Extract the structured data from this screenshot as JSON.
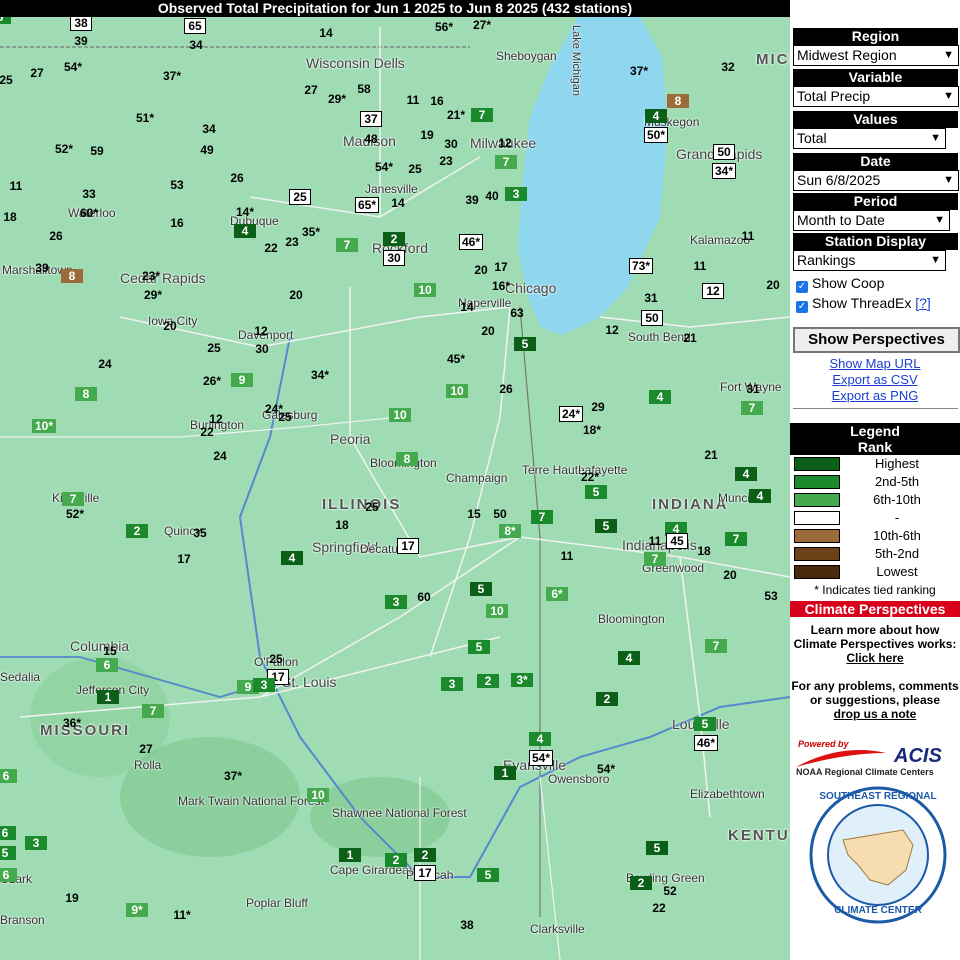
{
  "title": "Observed Total Precipitation for Jun 1 2025 to Jun 8 2025 (432 stations)",
  "panel": {
    "region_header": "Region",
    "region_value": "Midwest Region",
    "variable_header": "Variable",
    "variable_value": "Total Precip",
    "values_header": "Values",
    "values_value": "Total",
    "date_header": "Date",
    "date_value": "Sun 6/8/2025",
    "period_header": "Period",
    "period_value": "Month to Date",
    "station_header": "Station Display",
    "station_value": "Rankings",
    "show_coop": "Show Coop",
    "show_threadex": "Show ThreadEx",
    "help_link": "[?]",
    "show_perspectives": "Show Perspectives",
    "links": [
      "Show Map URL",
      "Export as CSV",
      "Export as PNG"
    ],
    "legend_title": "Legend",
    "legend_subtitle": "Rank",
    "legend": [
      {
        "label": "Highest",
        "color": "#0b5f17"
      },
      {
        "label": "2nd-5th",
        "color": "#1b8a2c"
      },
      {
        "label": "6th-10th",
        "color": "#45a94e"
      },
      {
        "label": "-",
        "color": "#ffffff"
      },
      {
        "label": "10th-6th",
        "color": "#9c6b3a"
      },
      {
        "label": "5th-2nd",
        "color": "#6b4218"
      },
      {
        "label": "Lowest",
        "color": "#4a2a0c"
      }
    ],
    "tied_note": "* Indicates tied ranking",
    "cp_header": "Climate Perspectives",
    "cp_text": "Learn more about how Climate Perspectives works:",
    "cp_link": "Click here",
    "problems_text": "For any problems, comments or suggestions, please",
    "problems_link": "drop us a note",
    "powered_by": "Powered by",
    "acis": "ACIS",
    "acis_sub": "NOAA Regional Climate Centers",
    "seal_top": "SOUTHEAST REGIONAL",
    "seal_bottom": "CLIMATE CENTER"
  },
  "map": {
    "places": [
      {
        "t": "Wisconsin Dells",
        "c": "med"
      },
      {
        "t": "Madison",
        "c": "med"
      },
      {
        "t": "Janesville",
        "c": ""
      },
      {
        "t": "Rockford",
        "c": "med"
      },
      {
        "t": "Milwaukee",
        "c": "med"
      },
      {
        "t": "Sheboygan",
        "c": ""
      },
      {
        "t": "Chicago",
        "c": "med"
      },
      {
        "t": "Naperville",
        "c": ""
      },
      {
        "t": "Cedar Rapids",
        "c": "med"
      },
      {
        "t": "Waterloo",
        "c": ""
      },
      {
        "t": "Dubuque",
        "c": ""
      },
      {
        "t": "Iowa City",
        "c": ""
      },
      {
        "t": "Davenport",
        "c": ""
      },
      {
        "t": "Galesburg",
        "c": ""
      },
      {
        "t": "Burlington",
        "c": ""
      },
      {
        "t": "Peoria",
        "c": "med"
      },
      {
        "t": "Bloomington",
        "c": ""
      },
      {
        "t": "ILLINOIS",
        "c": "big"
      },
      {
        "t": "Champaign",
        "c": ""
      },
      {
        "t": "Springfield",
        "c": "med"
      },
      {
        "t": "Decatur",
        "c": ""
      },
      {
        "t": "Quincy",
        "c": ""
      },
      {
        "t": "Kirksville",
        "c": ""
      },
      {
        "t": "Terre Haute",
        "c": ""
      },
      {
        "t": "Lafayette",
        "c": ""
      },
      {
        "t": "INDIANA",
        "c": "big"
      },
      {
        "t": "Indianapolis",
        "c": "med"
      },
      {
        "t": "Muncie",
        "c": ""
      },
      {
        "t": "Greenwood",
        "c": ""
      },
      {
        "t": "Bloomington",
        "c": ""
      },
      {
        "t": "Columbia",
        "c": "med"
      },
      {
        "t": "Jefferson City",
        "c": ""
      },
      {
        "t": "MISSOURI",
        "c": "big"
      },
      {
        "t": "Rolla",
        "c": ""
      },
      {
        "t": "O'Fallon",
        "c": ""
      },
      {
        "t": "St. Louis",
        "c": "med"
      },
      {
        "t": "Mark Twain National Forest",
        "c": ""
      },
      {
        "t": "Shawnee National Forest",
        "c": ""
      },
      {
        "t": "Cape Girardeau",
        "c": ""
      },
      {
        "t": "Poplar Bluff",
        "c": ""
      },
      {
        "t": "Paducah",
        "c": ""
      },
      {
        "t": "Evansville",
        "c": "med"
      },
      {
        "t": "Owensboro",
        "c": ""
      },
      {
        "t": "Louisville",
        "c": "med"
      },
      {
        "t": "Elizabethtown",
        "c": ""
      },
      {
        "t": "KENTUCKY",
        "c": "big"
      },
      {
        "t": "Bowling Green",
        "c": ""
      },
      {
        "t": "Clarksville",
        "c": ""
      },
      {
        "t": "Grand Rapids",
        "c": "med"
      },
      {
        "t": "Muskegon",
        "c": ""
      },
      {
        "t": "Kalamazoo",
        "c": ""
      },
      {
        "t": "South Bend",
        "c": ""
      },
      {
        "t": "Fort Wayne",
        "c": ""
      },
      {
        "t": "Sedalia",
        "c": ""
      },
      {
        "t": "Marshalltown",
        "c": ""
      },
      {
        "t": "Ozark",
        "c": ""
      },
      {
        "t": "Branson",
        "c": ""
      },
      {
        "t": "MICH",
        "c": "big"
      },
      {
        "t": "Lake Michigan",
        "c": ""
      }
    ],
    "stations": [
      {
        "v": "38",
        "k": "box"
      },
      {
        "v": "65",
        "k": "box"
      },
      {
        "v": "39",
        "k": ""
      },
      {
        "v": "34",
        "k": ""
      },
      {
        "v": "14",
        "k": ""
      },
      {
        "v": "56*",
        "k": ""
      },
      {
        "v": "27*",
        "k": ""
      },
      {
        "v": "25",
        "k": ""
      },
      {
        "v": "27",
        "k": ""
      },
      {
        "v": "54*",
        "k": ""
      },
      {
        "v": "37*",
        "k": ""
      },
      {
        "v": "27",
        "k": ""
      },
      {
        "v": "29*",
        "k": ""
      },
      {
        "v": "58",
        "k": ""
      },
      {
        "v": "11",
        "k": ""
      },
      {
        "v": "16",
        "k": ""
      },
      {
        "v": "37*",
        "k": ""
      },
      {
        "v": "32",
        "k": ""
      },
      {
        "v": "8",
        "k": "br"
      },
      {
        "v": "51*",
        "k": ""
      },
      {
        "v": "34",
        "k": ""
      },
      {
        "v": "37",
        "k": "box"
      },
      {
        "v": "21*",
        "k": ""
      },
      {
        "v": "7",
        "k": "md"
      },
      {
        "v": "4",
        "k": "dk"
      },
      {
        "v": "50*",
        "k": "box"
      },
      {
        "v": "52*",
        "k": ""
      },
      {
        "v": "59",
        "k": ""
      },
      {
        "v": "49",
        "k": ""
      },
      {
        "v": "48",
        "k": ""
      },
      {
        "v": "19",
        "k": ""
      },
      {
        "v": "30",
        "k": ""
      },
      {
        "v": "12",
        "k": ""
      },
      {
        "v": "50",
        "k": "box"
      },
      {
        "v": "34*",
        "k": "box"
      },
      {
        "v": "23",
        "k": ""
      },
      {
        "v": "7",
        "k": "lt"
      },
      {
        "v": "26",
        "k": ""
      },
      {
        "v": "54*",
        "k": ""
      },
      {
        "v": "25",
        "k": ""
      },
      {
        "v": "11",
        "k": ""
      },
      {
        "v": "53",
        "k": ""
      },
      {
        "v": "33",
        "k": ""
      },
      {
        "v": "25",
        "k": "box"
      },
      {
        "v": "40",
        "k": ""
      },
      {
        "v": "3",
        "k": "md"
      },
      {
        "v": "39",
        "k": ""
      },
      {
        "v": "18",
        "k": ""
      },
      {
        "v": "60*",
        "k": ""
      },
      {
        "v": "16",
        "k": ""
      },
      {
        "v": "14*",
        "k": ""
      },
      {
        "v": "65*",
        "k": "box"
      },
      {
        "v": "14",
        "k": ""
      },
      {
        "v": "4",
        "k": "dk"
      },
      {
        "v": "35*",
        "k": ""
      },
      {
        "v": "26",
        "k": ""
      },
      {
        "v": "22",
        "k": ""
      },
      {
        "v": "23",
        "k": ""
      },
      {
        "v": "7",
        "k": "lt"
      },
      {
        "v": "2",
        "k": "dk"
      },
      {
        "v": "46*",
        "k": "box"
      },
      {
        "v": "11",
        "k": ""
      },
      {
        "v": "39",
        "k": ""
      },
      {
        "v": "8",
        "k": "br"
      },
      {
        "v": "23*",
        "k": ""
      },
      {
        "v": "30",
        "k": "box"
      },
      {
        "v": "29*",
        "k": ""
      },
      {
        "v": "20",
        "k": ""
      },
      {
        "v": "17",
        "k": ""
      },
      {
        "v": "73*",
        "k": "box"
      },
      {
        "v": "11",
        "k": ""
      },
      {
        "v": "20",
        "k": ""
      },
      {
        "v": "10",
        "k": "lt"
      },
      {
        "v": "16*",
        "k": ""
      },
      {
        "v": "31",
        "k": ""
      },
      {
        "v": "12",
        "k": "box"
      },
      {
        "v": "20",
        "k": ""
      },
      {
        "v": "20",
        "k": ""
      },
      {
        "v": "14",
        "k": ""
      },
      {
        "v": "63",
        "k": ""
      },
      {
        "v": "20",
        "k": ""
      },
      {
        "v": "12",
        "k": ""
      },
      {
        "v": "50",
        "k": "box"
      },
      {
        "v": "12",
        "k": ""
      },
      {
        "v": "21",
        "k": ""
      },
      {
        "v": "30",
        "k": ""
      },
      {
        "v": "25",
        "k": ""
      },
      {
        "v": "5",
        "k": "dk"
      },
      {
        "v": "24",
        "k": ""
      },
      {
        "v": "45*",
        "k": ""
      },
      {
        "v": "26*",
        "k": ""
      },
      {
        "v": "9",
        "k": "lt"
      },
      {
        "v": "34*",
        "k": ""
      },
      {
        "v": "26",
        "k": ""
      },
      {
        "v": "10",
        "k": "lt"
      },
      {
        "v": "8",
        "k": "lt"
      },
      {
        "v": "31",
        "k": ""
      },
      {
        "v": "24*",
        "k": "box"
      },
      {
        "v": "29",
        "k": ""
      },
      {
        "v": "4",
        "k": "md"
      },
      {
        "v": "7",
        "k": "lt"
      },
      {
        "v": "24*",
        "k": ""
      },
      {
        "v": "25",
        "k": ""
      },
      {
        "v": "10",
        "k": "lt"
      },
      {
        "v": "12",
        "k": ""
      },
      {
        "v": "10*",
        "k": "lt"
      },
      {
        "v": "22",
        "k": ""
      },
      {
        "v": "18*",
        "k": ""
      },
      {
        "v": "8",
        "k": "lt"
      },
      {
        "v": "21",
        "k": ""
      },
      {
        "v": "24",
        "k": ""
      },
      {
        "v": "22*",
        "k": ""
      },
      {
        "v": "4",
        "k": "dk"
      },
      {
        "v": "5",
        "k": "md"
      },
      {
        "v": "4",
        "k": "dk"
      },
      {
        "v": "7",
        "k": "lt"
      },
      {
        "v": "52*",
        "k": ""
      },
      {
        "v": "25",
        "k": ""
      },
      {
        "v": "15",
        "k": ""
      },
      {
        "v": "50",
        "k": ""
      },
      {
        "v": "7",
        "k": "md"
      },
      {
        "v": "5",
        "k": "dk"
      },
      {
        "v": "4",
        "k": "md"
      },
      {
        "v": "2",
        "k": "md"
      },
      {
        "v": "35",
        "k": ""
      },
      {
        "v": "18",
        "k": ""
      },
      {
        "v": "17",
        "k": "box"
      },
      {
        "v": "11",
        "k": ""
      },
      {
        "v": "45",
        "k": "box"
      },
      {
        "v": "7",
        "k": "md"
      },
      {
        "v": "8*",
        "k": "lt"
      },
      {
        "v": "11",
        "k": ""
      },
      {
        "v": "7",
        "k": "lt"
      },
      {
        "v": "18",
        "k": ""
      },
      {
        "v": "17",
        "k": ""
      },
      {
        "v": "4",
        "k": "dk"
      },
      {
        "v": "20",
        "k": ""
      },
      {
        "v": "6*",
        "k": "lt"
      },
      {
        "v": "5",
        "k": "dk"
      },
      {
        "v": "53",
        "k": ""
      },
      {
        "v": "3",
        "k": "md"
      },
      {
        "v": "60",
        "k": ""
      },
      {
        "v": "10",
        "k": "lt"
      },
      {
        "v": "4",
        "k": "md"
      },
      {
        "v": "6",
        "k": "lt"
      },
      {
        "v": "5",
        "k": "md"
      },
      {
        "v": "4",
        "k": "dk"
      },
      {
        "v": "25",
        "k": ""
      },
      {
        "v": "17",
        "k": "box"
      },
      {
        "v": "9",
        "k": "lt"
      },
      {
        "v": "3",
        "k": "md"
      },
      {
        "v": "2",
        "k": "md"
      },
      {
        "v": "3*",
        "k": "md"
      },
      {
        "v": "1",
        "k": "dk"
      },
      {
        "v": "3",
        "k": "md"
      },
      {
        "v": "2",
        "k": "dk"
      },
      {
        "v": "36*",
        "k": ""
      },
      {
        "v": "7",
        "k": "lt"
      },
      {
        "v": "5",
        "k": "md"
      },
      {
        "v": "46*",
        "k": "box"
      },
      {
        "v": "27",
        "k": ""
      },
      {
        "v": "4",
        "k": "md"
      },
      {
        "v": "54*",
        "k": "box"
      },
      {
        "v": "54*",
        "k": ""
      },
      {
        "v": "37*",
        "k": ""
      },
      {
        "v": "1",
        "k": "dk"
      },
      {
        "v": "10",
        "k": "lt"
      },
      {
        "v": "6",
        "k": "lt"
      },
      {
        "v": "3",
        "k": "md"
      },
      {
        "v": "1",
        "k": "dk"
      },
      {
        "v": "2",
        "k": "md"
      },
      {
        "v": "2",
        "k": "dk"
      },
      {
        "v": "17",
        "k": "box"
      },
      {
        "v": "5",
        "k": "md"
      },
      {
        "v": "5",
        "k": "dk"
      },
      {
        "v": "19",
        "k": ""
      },
      {
        "v": "9*",
        "k": "lt"
      },
      {
        "v": "11*",
        "k": ""
      },
      {
        "v": "2",
        "k": "dk"
      },
      {
        "v": "52",
        "k": ""
      },
      {
        "v": "22",
        "k": ""
      },
      {
        "v": "38",
        "k": ""
      },
      {
        "v": "15",
        "k": ""
      },
      {
        "v": "6",
        "k": "md"
      },
      {
        "v": "5",
        "k": "md"
      },
      {
        "v": "6",
        "k": "lt"
      },
      {
        "v": "7",
        "k": "lt"
      },
      {
        "v": "5",
        "k": "md"
      }
    ]
  }
}
